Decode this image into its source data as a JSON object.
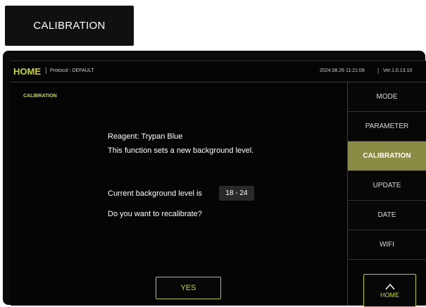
{
  "tag_label": "CALIBRATION",
  "topbar": {
    "title": "HOME",
    "separator": "|",
    "protocol": "Protocol : DEFAULT",
    "datetime": "2024.08.26 11:21:08",
    "separator2": "|",
    "version": "Ver.1.0.13.10"
  },
  "panel": {
    "title": "CALIBRATION",
    "reagent": "Reagent: Trypan Blue",
    "description": "This function sets a new background level.",
    "bg_label": "Current background level is",
    "bg_value": "18 - 24",
    "question": "Do you want to recalibrate?",
    "yes": "YES"
  },
  "menu": {
    "items": [
      {
        "label": "MODE"
      },
      {
        "label": "PARAMETER"
      },
      {
        "label": "CALIBRATION"
      },
      {
        "label": "UPDATE"
      },
      {
        "label": "DATE"
      },
      {
        "label": "WIFI"
      }
    ],
    "home": "HOME",
    "active_color": "#8a8b45",
    "accent_color": "#c9d43a"
  }
}
